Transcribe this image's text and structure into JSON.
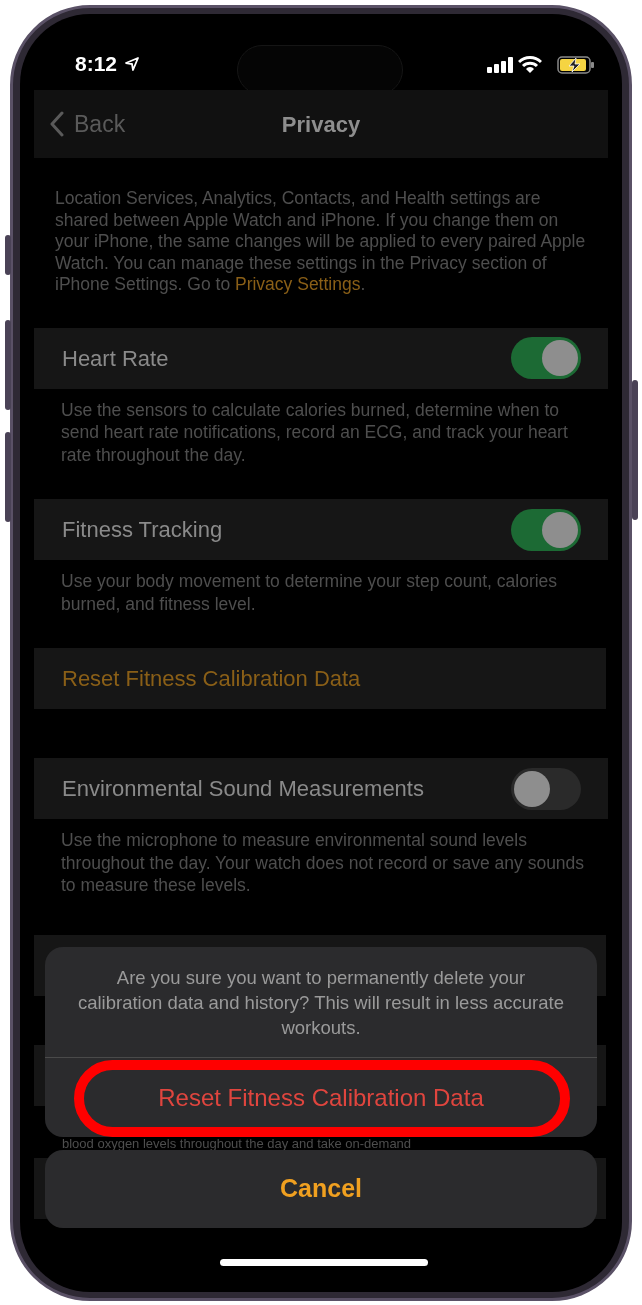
{
  "status_bar": {
    "time": "8:12"
  },
  "nav": {
    "back": "Back",
    "title": "Privacy"
  },
  "intro": {
    "text": "Location Services, Analytics, Contacts, and Health settings are shared between Apple Watch and iPhone. If you change them on your iPhone, the same changes will be applied to every paired Apple Watch. You can manage these settings in the Privacy section of iPhone Settings. Go to ",
    "link": "Privacy Settings",
    "after": "."
  },
  "settings": [
    {
      "kind": "toggle",
      "label": "Heart Rate",
      "on": true,
      "description": "Use the sensors to calculate calories burned, determine when to send heart rate notifications, record an ECG, and track your heart rate throughout the day."
    },
    {
      "kind": "toggle",
      "label": "Fitness Tracking",
      "on": true,
      "description": "Use your body movement to determine your step count, calories burned, and fitness level."
    },
    {
      "kind": "action",
      "label": "Reset Fitness Calibration Data"
    },
    {
      "kind": "toggle",
      "label": "Environmental Sound Measurements",
      "on": false,
      "description": "Use the microphone to measure environmental sound levels throughout the day. Your watch does not record or save any sounds to measure these levels."
    }
  ],
  "covered_text": "blood oxygen levels throughout the day and take on-demand",
  "action_sheet": {
    "message": "Are you sure you want to permanently delete your calibration data and history? This will result in less accurate workouts.",
    "action": "Reset Fitness Calibration Data",
    "highlighted": true,
    "cancel": "Cancel"
  }
}
